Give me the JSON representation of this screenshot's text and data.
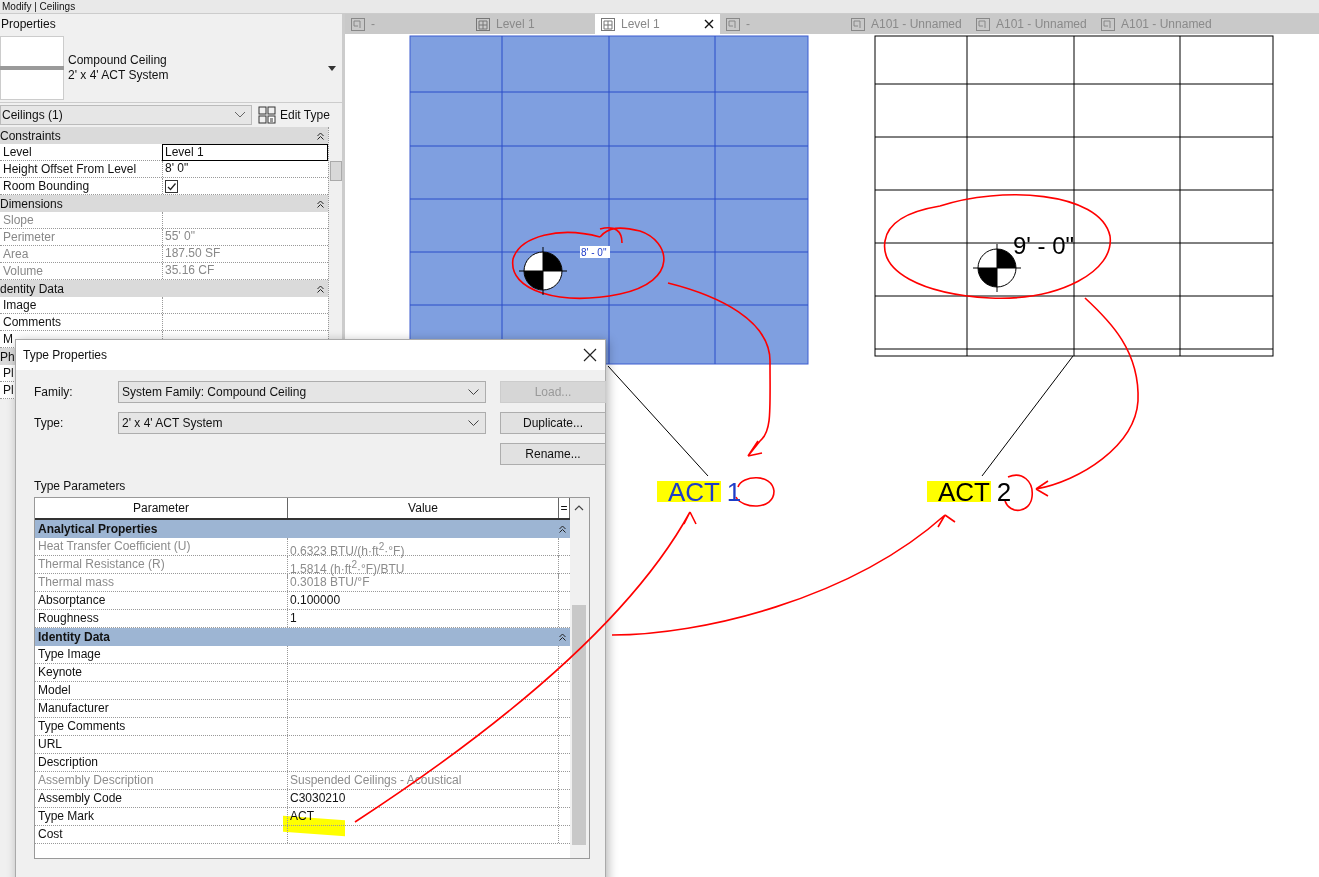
{
  "ribbon_context": "Modify | Ceilings",
  "properties": {
    "title": "Properties",
    "type_family": "Compound Ceiling",
    "type_name": "2' x 4' ACT System",
    "selector": "Ceilings (1)",
    "edit_type": "Edit Type",
    "groups": [
      {
        "name": "Constraints",
        "rows": [
          {
            "kind": "text",
            "label": "Level",
            "value": "Level 1",
            "disabled": false,
            "editing": true
          },
          {
            "kind": "text",
            "label": "Height Offset From Level",
            "value": "8'  0\"",
            "disabled": false,
            "editing": false
          },
          {
            "kind": "checkbox",
            "label": "Room Bounding",
            "checked": true,
            "disabled": false,
            "editing": false
          }
        ]
      },
      {
        "name": "Dimensions",
        "rows": [
          {
            "kind": "text",
            "label": "Slope",
            "value": "",
            "disabled": true,
            "editing": false
          },
          {
            "kind": "text",
            "label": "Perimeter",
            "value": "55'  0\"",
            "disabled": true,
            "editing": false
          },
          {
            "kind": "text",
            "label": "Area",
            "value": "187.50 SF",
            "disabled": true,
            "editing": false
          },
          {
            "kind": "text",
            "label": "Volume",
            "value": "35.16 CF",
            "disabled": true,
            "editing": false
          }
        ]
      },
      {
        "name": "dentity Data",
        "rows": [
          {
            "kind": "text",
            "label": "Image",
            "value": "",
            "disabled": false,
            "editing": false
          },
          {
            "kind": "text",
            "label": "Comments",
            "value": "",
            "disabled": false,
            "editing": false
          },
          {
            "kind": "text",
            "label": "M",
            "value": "",
            "disabled": false,
            "editing": false
          }
        ]
      },
      {
        "name": "Ph",
        "rows": [
          {
            "kind": "text",
            "label": "Pl",
            "value": "",
            "disabled": false
          },
          {
            "kind": "text",
            "label": "Pl",
            "value": "",
            "disabled": false
          }
        ]
      }
    ]
  },
  "view_tabs": [
    {
      "label": "-",
      "selected": false
    },
    {
      "label": "Level 1",
      "selected": false
    },
    {
      "label": "Level 1",
      "selected": true
    },
    {
      "label": "-",
      "selected": false
    },
    {
      "label": "A101 - Unnamed",
      "selected": false
    },
    {
      "label": "A101 - Unnamed",
      "selected": false
    },
    {
      "label": "A101 - Unnamed",
      "selected": false
    }
  ],
  "ceilings": [
    {
      "height": "8' - 0\"",
      "tag": "ACT",
      "tag_number": "1",
      "selected": true
    },
    {
      "height": "9' - 0\"",
      "tag": "ACT",
      "tag_number": "2",
      "selected": false
    }
  ],
  "type_dialog": {
    "title": "Type Properties",
    "fields": [
      {
        "label": "Family:",
        "value": "System Family: Compound Ceiling"
      },
      {
        "label": "Type:",
        "value": "2' x 4' ACT System"
      }
    ],
    "buttons": [
      {
        "label": "Load...",
        "disabled": true
      },
      {
        "label": "Duplicate...",
        "disabled": false
      },
      {
        "label": "Rename...",
        "disabled": false
      }
    ],
    "section_label": "Type Parameters",
    "columns": [
      "Parameter",
      "Value",
      "="
    ],
    "groups": [
      {
        "name": "Analytical Properties",
        "rows": [
          {
            "parameter": "Heat Transfer Coefficient (U)",
            "value": "0.6323 BTU/(h·ft$^{2}$·°F)",
            "disabled": true
          },
          {
            "parameter": "Thermal Resistance (R)",
            "value": "1.5814 (h·ft$^{2}$·°F)/BTU",
            "disabled": true
          },
          {
            "parameter": "Thermal mass",
            "value": "0.3018 BTU/°F",
            "disabled": true
          },
          {
            "parameter": "Absorptance",
            "value": "0.100000",
            "disabled": false
          },
          {
            "parameter": "Roughness",
            "value": "1",
            "disabled": false
          }
        ]
      },
      {
        "name": "Identity Data",
        "rows": [
          {
            "parameter": "Type Image",
            "value": "",
            "disabled": false
          },
          {
            "parameter": "Keynote",
            "value": "",
            "disabled": false
          },
          {
            "parameter": "Model",
            "value": "",
            "disabled": false
          },
          {
            "parameter": "Manufacturer",
            "value": "",
            "disabled": false
          },
          {
            "parameter": "Type Comments",
            "value": "",
            "disabled": false
          },
          {
            "parameter": "URL",
            "value": "",
            "disabled": false
          },
          {
            "parameter": "Description",
            "value": "",
            "disabled": false
          },
          {
            "parameter": "Assembly Description",
            "value": "Suspended Ceilings - Acoustical",
            "disabled": true
          },
          {
            "parameter": "Assembly Code",
            "value": "C3030210",
            "disabled": false
          },
          {
            "parameter": "Type Mark",
            "value": "ACT",
            "disabled": false
          },
          {
            "parameter": "Cost",
            "value": "",
            "disabled": false
          }
        ]
      }
    ]
  }
}
